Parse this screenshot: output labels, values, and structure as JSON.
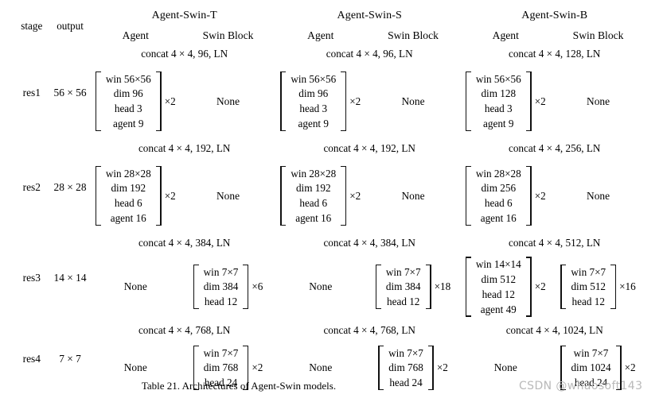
{
  "table": {
    "header": {
      "stage": "stage",
      "output": "output",
      "models": [
        "Agent-Swin-T",
        "Agent-Swin-S",
        "Agent-Swin-B"
      ],
      "sub_agent": "Agent",
      "sub_swin": "Swin Block"
    },
    "none_label": "None",
    "stages": [
      {
        "stage": "res1",
        "output": "56 × 56",
        "models": [
          {
            "name": "Agent-Swin-T",
            "concat": "concat 4 × 4, 96, LN",
            "agent": {
              "lines": [
                "win 56×56",
                "dim 96",
                "head 3",
                "agent 9"
              ],
              "repeat": "×2"
            },
            "swin": null
          },
          {
            "name": "Agent-Swin-S",
            "concat": "concat 4 × 4, 96, LN",
            "agent": {
              "lines": [
                "win 56×56",
                "dim 96",
                "head 3",
                "agent 9"
              ],
              "repeat": "×2"
            },
            "swin": null
          },
          {
            "name": "Agent-Swin-B",
            "concat": "concat 4 × 4, 128, LN",
            "agent": {
              "lines": [
                "win 56×56",
                "dim 128",
                "head 3",
                "agent 9"
              ],
              "repeat": "×2"
            },
            "swin": null
          }
        ]
      },
      {
        "stage": "res2",
        "output": "28 × 28",
        "models": [
          {
            "name": "Agent-Swin-T",
            "concat": "concat 4 × 4, 192, LN",
            "agent": {
              "lines": [
                "win 28×28",
                "dim 192",
                "head 6",
                "agent 16"
              ],
              "repeat": "×2"
            },
            "swin": null
          },
          {
            "name": "Agent-Swin-S",
            "concat": "concat 4 × 4, 192, LN",
            "agent": {
              "lines": [
                "win 28×28",
                "dim 192",
                "head 6",
                "agent 16"
              ],
              "repeat": "×2"
            },
            "swin": null
          },
          {
            "name": "Agent-Swin-B",
            "concat": "concat 4 × 4, 256, LN",
            "agent": {
              "lines": [
                "win 28×28",
                "dim 256",
                "head 6",
                "agent 16"
              ],
              "repeat": "×2"
            },
            "swin": null
          }
        ]
      },
      {
        "stage": "res3",
        "output": "14 × 14",
        "models": [
          {
            "name": "Agent-Swin-T",
            "concat": "concat 4 × 4, 384, LN",
            "agent": null,
            "swin": {
              "lines": [
                "win 7×7",
                "dim 384",
                "head 12"
              ],
              "repeat": "×6"
            }
          },
          {
            "name": "Agent-Swin-S",
            "concat": "concat 4 × 4, 384, LN",
            "agent": null,
            "swin": {
              "lines": [
                "win 7×7",
                "dim 384",
                "head 12"
              ],
              "repeat": "×18"
            }
          },
          {
            "name": "Agent-Swin-B",
            "concat": "concat 4 × 4, 512, LN",
            "agent": {
              "lines": [
                "win 14×14",
                "dim 512",
                "head 12",
                "agent 49"
              ],
              "repeat": "×2"
            },
            "swin": {
              "lines": [
                "win 7×7",
                "dim 512",
                "head 12"
              ],
              "repeat": "×16"
            }
          }
        ]
      },
      {
        "stage": "res4",
        "output": "7 × 7",
        "models": [
          {
            "name": "Agent-Swin-T",
            "concat": "concat 4 × 4, 768, LN",
            "agent": null,
            "swin": {
              "lines": [
                "win 7×7",
                "dim 768",
                "head 24"
              ],
              "repeat": "×2"
            }
          },
          {
            "name": "Agent-Swin-S",
            "concat": "concat 4 × 4, 768, LN",
            "agent": null,
            "swin": {
              "lines": [
                "win 7×7",
                "dim 768",
                "head 24"
              ],
              "repeat": "×2"
            }
          },
          {
            "name": "Agent-Swin-B",
            "concat": "concat 4 × 4, 1024, LN",
            "agent": null,
            "swin": {
              "lines": [
                "win 7×7",
                "dim 1024",
                "head 24"
              ],
              "repeat": "×2"
            }
          }
        ]
      }
    ]
  },
  "caption": "Table 21. Architectures of Agent-Swin models.",
  "watermark": "CSDN @whaosoft143"
}
